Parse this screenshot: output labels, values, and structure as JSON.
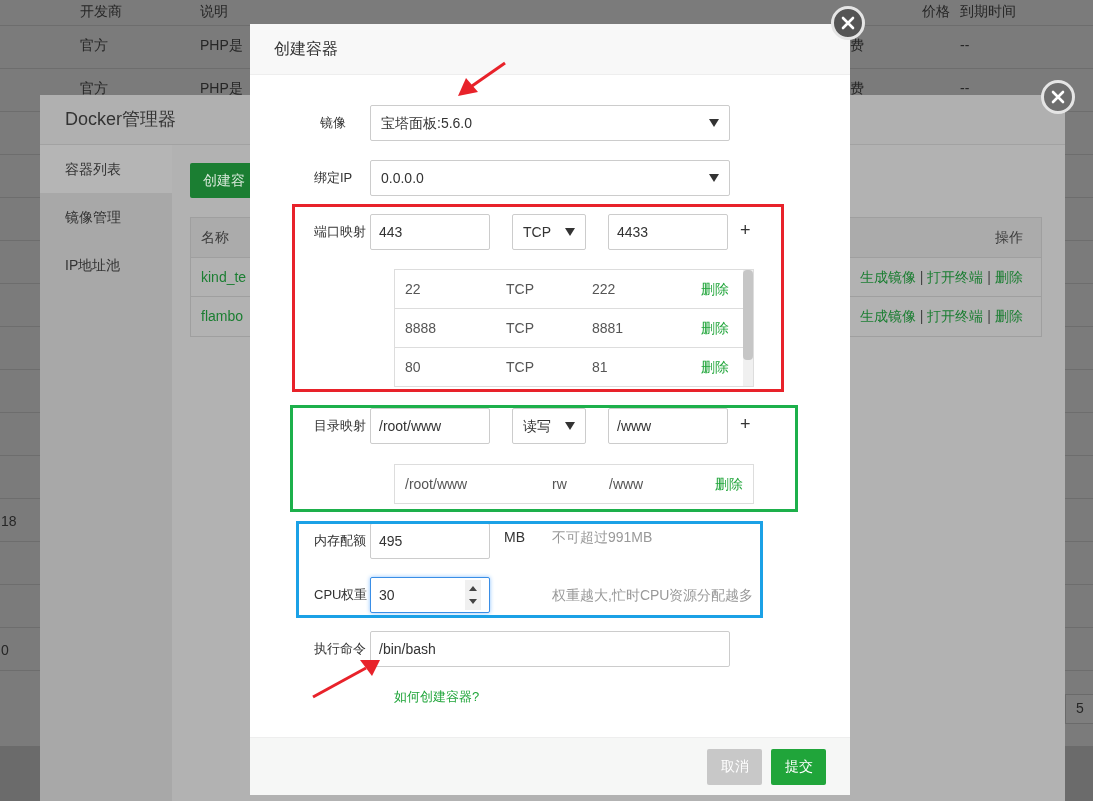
{
  "background_table": {
    "columns": [
      {
        "kind": "developer",
        "label": "开发商"
      },
      {
        "kind": "description",
        "label": "说明"
      },
      {
        "kind": "price",
        "label": "价格"
      },
      {
        "kind": "expiry",
        "label": "到期时间"
      }
    ],
    "rows": [
      {
        "developer": "官方",
        "description": "PHP是",
        "price": "费",
        "expiry": "--"
      },
      {
        "developer": "官方",
        "description": "PHP是",
        "price": "费",
        "expiry": "--"
      },
      {},
      {},
      {},
      {},
      {},
      {},
      {},
      {},
      {},
      {
        "column_0": "18"
      },
      {},
      {},
      {
        "column_0": "0"
      }
    ],
    "pagination": [
      "5"
    ]
  },
  "docker_dialog": {
    "title": "Docker管理器",
    "tabs": [
      {
        "label": "容器列表",
        "selected": true
      },
      {
        "label": "镜像管理",
        "selected": false
      },
      {
        "label": "IP地址池",
        "selected": false
      }
    ],
    "create_button": "创建容",
    "table": {
      "columns": [
        "名称",
        "操作"
      ],
      "rows": [
        {
          "name": "kind_te",
          "actions": [
            {
              "kind": "link",
              "text": "生成镜像"
            },
            {
              "kind": "separator",
              "text": "|"
            },
            {
              "kind": "link",
              "text": "打开终端"
            },
            {
              "kind": "separator",
              "text": "|"
            },
            {
              "kind": "link",
              "text": "删除"
            }
          ]
        },
        {
          "name": "flambo",
          "actions": [
            {
              "kind": "link",
              "text": "生成镜像"
            },
            {
              "kind": "separator",
              "text": "|"
            },
            {
              "kind": "link",
              "text": "打开终端"
            },
            {
              "kind": "separator",
              "text": "|"
            },
            {
              "kind": "link",
              "text": "删除"
            }
          ]
        }
      ]
    }
  },
  "create_dialog": {
    "title": "创建容器",
    "image": {
      "label": "镜像",
      "value": "宝塔面板:5.6.0"
    },
    "bind_ip": {
      "label": "绑定IP",
      "value": "0.0.0.0"
    },
    "port_mapping": {
      "label": "端口映射",
      "host_port": "443",
      "protocol": "TCP",
      "container_port": "4433",
      "add": "+",
      "entries": [
        {
          "host": "22",
          "protocol": "TCP",
          "container": "222",
          "delete": "删除"
        },
        {
          "host": "8888",
          "protocol": "TCP",
          "container": "8881",
          "delete": "删除"
        },
        {
          "host": "80",
          "protocol": "TCP",
          "container": "81",
          "delete": "删除"
        }
      ]
    },
    "dir_mapping": {
      "label": "目录映射",
      "host_dir": "/root/www",
      "mode": "读写",
      "container_dir": "/www",
      "add": "+",
      "entries": [
        {
          "host": "/root/www",
          "mode": "rw",
          "container": "/www",
          "delete": "删除"
        }
      ]
    },
    "memory": {
      "label": "内存配额",
      "value": "495",
      "unit": "MB",
      "hint": "不可超过991MB"
    },
    "cpu": {
      "label": "CPU权重",
      "value": "30",
      "hint": "权重越大,忙时CPU资源分配越多",
      "focused": true
    },
    "command": {
      "label": "执行命令",
      "value": "/bin/bash"
    },
    "help_link": "如何创建容器?",
    "buttons": [
      {
        "kind": "cancel",
        "label": "取消"
      },
      {
        "kind": "submit",
        "label": "提交"
      }
    ]
  }
}
